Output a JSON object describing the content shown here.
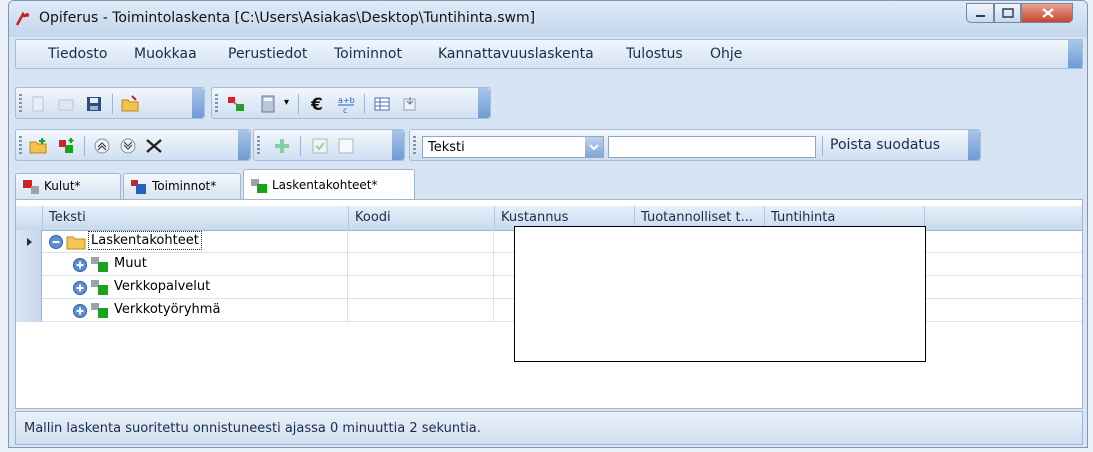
{
  "window": {
    "title": "Opiferus - Toimintolaskenta [C:\\Users\\Asiakas\\Desktop\\Tuntihinta.swm]"
  },
  "menu": {
    "items": [
      "Tiedosto",
      "Muokkaa",
      "Perustiedot",
      "Toiminnot",
      "Kannattavuuslaskenta",
      "Tulostus",
      "Ohje"
    ]
  },
  "toolbar2": {
    "filter_field_value": "Teksti",
    "filter_input_value": "",
    "clear_filter_label": "Poista suodatus"
  },
  "tabs": [
    {
      "label": "Kulut*",
      "active": false
    },
    {
      "label": "Toiminnot*",
      "active": false
    },
    {
      "label": "Laskentakohteet*",
      "active": true
    }
  ],
  "grid": {
    "columns": [
      "Teksti",
      "Koodi",
      "Kustannus",
      "Tuotannolliset t...",
      "Tuntihinta"
    ],
    "rows": [
      {
        "text": "Laskentakohteet",
        "code": "",
        "selected": true
      },
      {
        "text": "Muut",
        "code": ""
      },
      {
        "text": "Verkkopalvelut",
        "code": ""
      },
      {
        "text": "Verkkotyöryhmä",
        "code": ""
      }
    ]
  },
  "status": {
    "message": "Mallin laskenta suoritettu onnistuneesti ajassa 0 minuuttia 2 sekuntia."
  },
  "colors": {
    "accent": "#6d9bd4",
    "icon_red": "#d42020",
    "icon_green": "#1aa31a",
    "icon_blue": "#2a5fc4"
  }
}
